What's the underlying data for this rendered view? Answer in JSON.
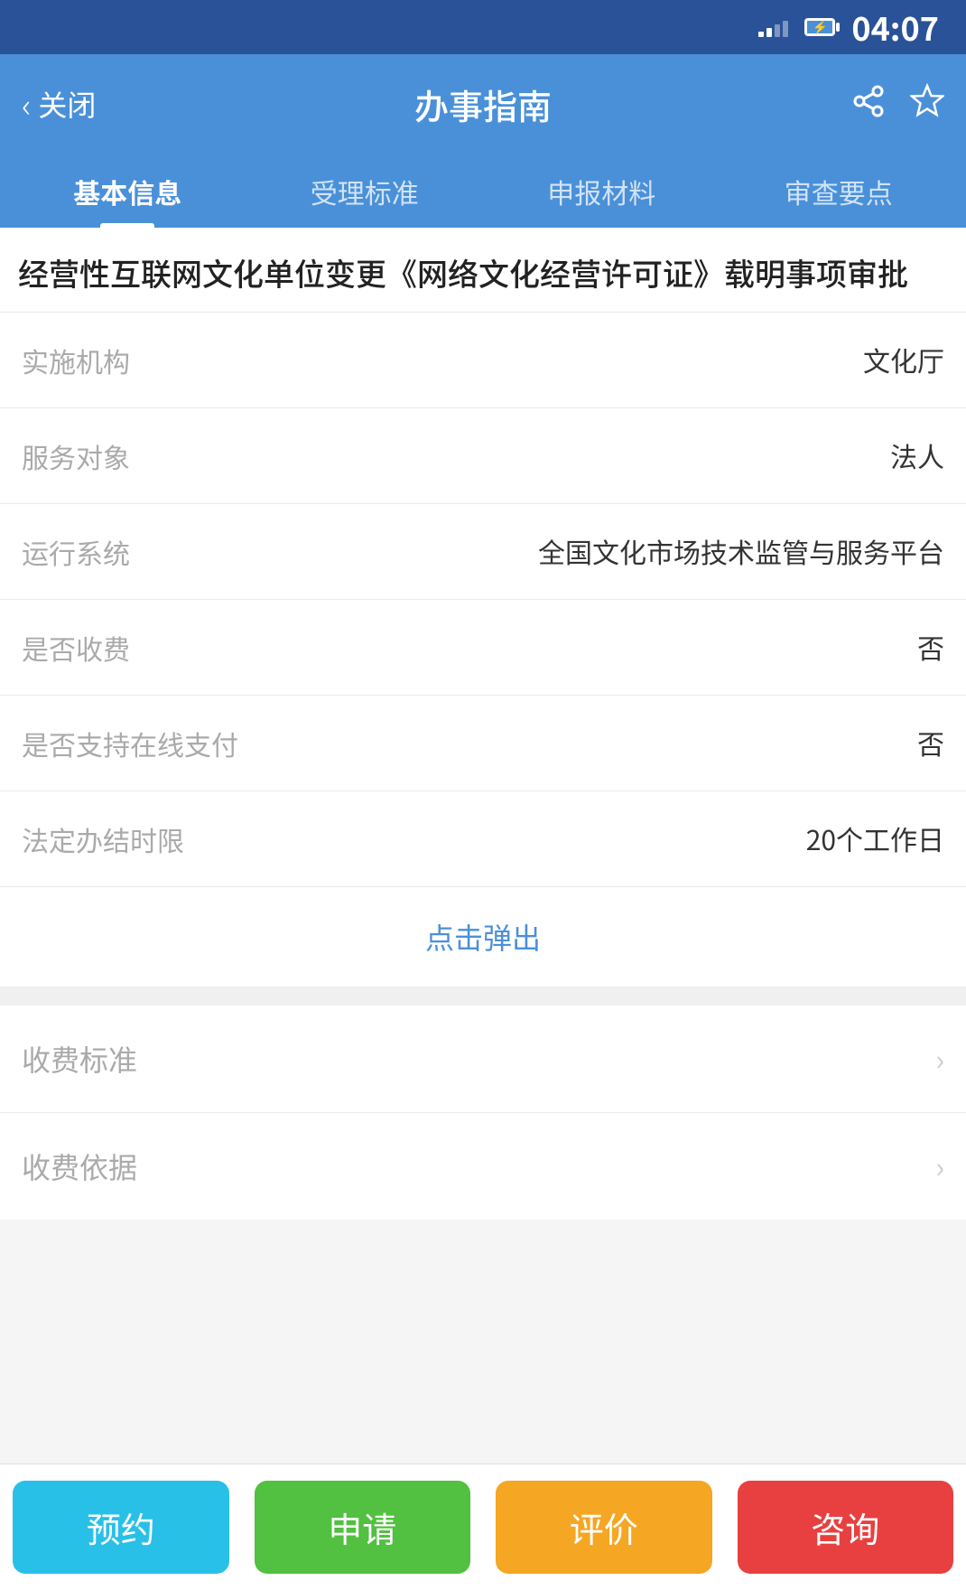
{
  "status_bar": {
    "time": "04:07"
  },
  "nav": {
    "back_label": "关闭",
    "title": "办事指南",
    "share_icon": "share-icon",
    "star_icon": "star-icon"
  },
  "tabs": [
    {
      "id": "basic",
      "label": "基本信息",
      "active": true
    },
    {
      "id": "standard",
      "label": "受理标准",
      "active": false
    },
    {
      "id": "materials",
      "label": "申报材料",
      "active": false
    },
    {
      "id": "review",
      "label": "审查要点",
      "active": false
    }
  ],
  "page_title": "经营性互联网文化单位变更《网络文化经营许可证》载明事项审批",
  "info_rows": [
    {
      "label": "实施机构",
      "value": "文化厅"
    },
    {
      "label": "服务对象",
      "value": "法人"
    },
    {
      "label": "运行系统",
      "value": "全国文化市场技术监管与服务平台"
    },
    {
      "label": "是否收费",
      "value": "否"
    },
    {
      "label": "是否支持在线支付",
      "value": "否"
    },
    {
      "label": "法定办结时限",
      "value": "20个工作日"
    }
  ],
  "popup_link": "点击弹出",
  "list_rows": [
    {
      "label": "收费标准"
    },
    {
      "label": "收费依据"
    }
  ],
  "bottom_actions": [
    {
      "label": "预约",
      "class": "yuyue"
    },
    {
      "label": "申请",
      "class": "shenqing"
    },
    {
      "label": "评价",
      "class": "pingjia"
    },
    {
      "label": "咨询",
      "class": "zixun"
    }
  ]
}
